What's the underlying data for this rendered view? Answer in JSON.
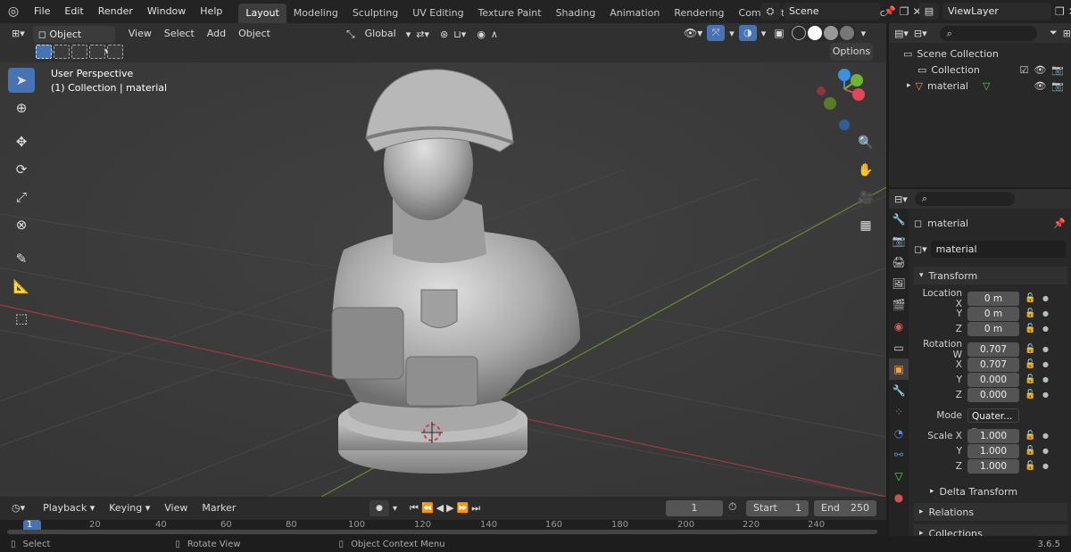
{
  "menubar": {
    "items": [
      "File",
      "Edit",
      "Render",
      "Window",
      "Help"
    ],
    "workspaces": [
      "Layout",
      "Modeling",
      "Sculpting",
      "UV Editing",
      "Texture Paint",
      "Shading",
      "Animation",
      "Rendering",
      "Compositing",
      "Geometry Noc"
    ],
    "active_workspace": "Layout",
    "scene_name": "Scene",
    "view_layer": "ViewLayer"
  },
  "viewport_header": {
    "mode": "Object Mode",
    "menus": [
      "View",
      "Select",
      "Add",
      "Object"
    ],
    "transform_orientation": "Global",
    "options_label": "Options"
  },
  "viewport": {
    "perspective": "User Perspective",
    "collection_info": "(1) Collection | material"
  },
  "outliner": {
    "items": [
      {
        "label": "Scene Collection"
      },
      {
        "label": "Collection"
      },
      {
        "label": "material"
      }
    ]
  },
  "properties": {
    "object_name": "material",
    "data_name": "material",
    "transform_label": "Transform",
    "location": {
      "label_x": "Location X",
      "x": "0 m",
      "y": "0 m",
      "z": "0 m"
    },
    "rotation": {
      "label_w": "Rotation W",
      "w": "0.707",
      "x": "0.707",
      "y": "0.000",
      "z": "0.000"
    },
    "mode": {
      "label": "Mode",
      "value": "Quater..."
    },
    "scale": {
      "label_x": "Scale X",
      "x": "1.000",
      "y": "1.000",
      "z": "1.000"
    },
    "axis_y": "Y",
    "axis_z": "Z",
    "axis_x": "X",
    "delta_transform": "Delta Transform",
    "relations": "Relations",
    "collections": "Collections"
  },
  "timeline": {
    "menus": [
      "Playback",
      "Keying",
      "View",
      "Marker"
    ],
    "current_frame": "1",
    "start_label": "Start",
    "start": "1",
    "end_label": "End",
    "end": "250",
    "ruler": [
      "1",
      "20",
      "40",
      "60",
      "80",
      "100",
      "120",
      "140",
      "160",
      "180",
      "200",
      "220",
      "240"
    ]
  },
  "statusbar": {
    "select": "Select",
    "rotate": "Rotate View",
    "context": "Object Context Menu",
    "version": "3.6.5"
  },
  "colors": {
    "accent": "#4772b3",
    "axis_x": "#e0485a",
    "axis_y": "#73b332",
    "axis_z": "#3d8fe0"
  }
}
